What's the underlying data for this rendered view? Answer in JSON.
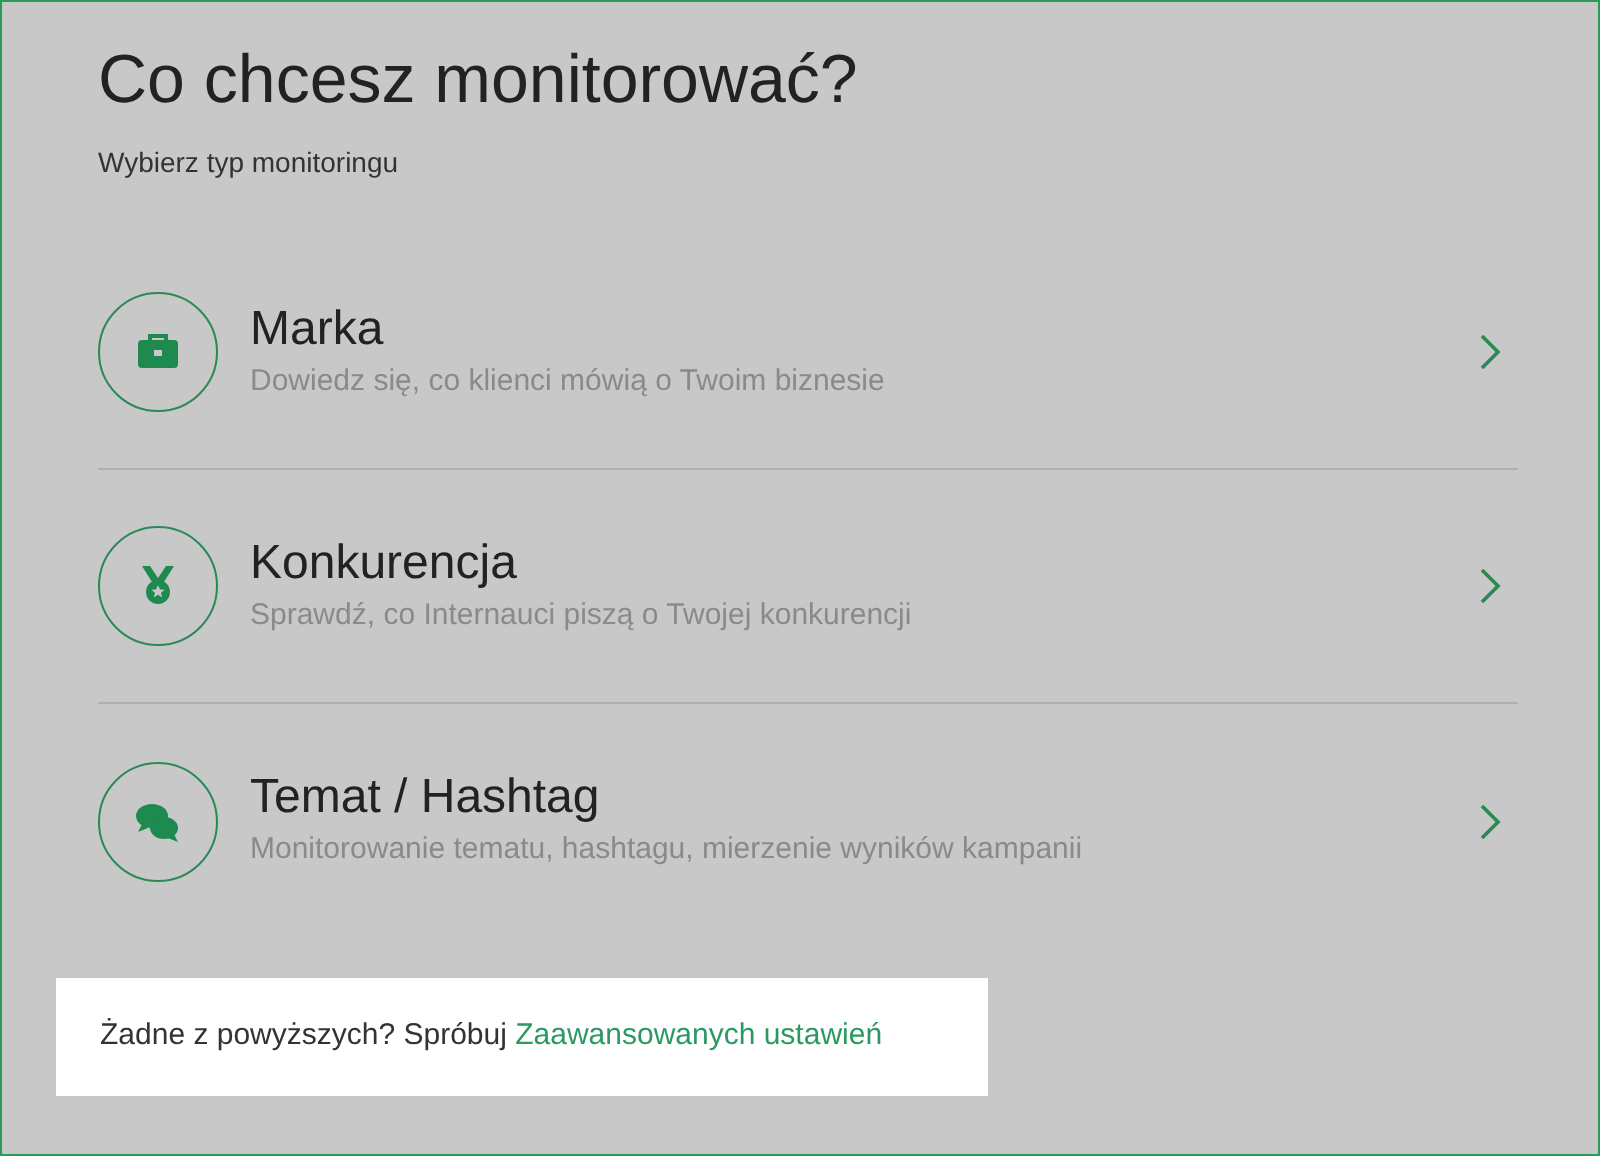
{
  "title": "Co chcesz monitorować?",
  "subtitle": "Wybierz typ monitoringu",
  "options": [
    {
      "kind": "briefcase",
      "title": "Marka",
      "description": "Dowiedz się, co klienci mówią o Twoim biznesie"
    },
    {
      "kind": "medal",
      "title": "Konkurencja",
      "description": "Sprawdź, co Internauci piszą o Twojej konkurencji"
    },
    {
      "kind": "chat",
      "title": "Temat / Hashtag",
      "description": "Monitorowanie tematu, hashtagu, mierzenie wyników kampanii"
    }
  ],
  "footer": {
    "text": "Żadne z powyższych? Spróbuj ",
    "link": "Zaawansowanych ustawień"
  }
}
